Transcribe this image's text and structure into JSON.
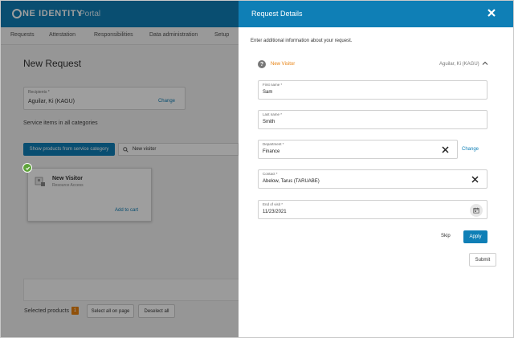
{
  "app": {
    "brand": "ONE IDENTITY",
    "brand_rest": "NE IDENTITY",
    "portal": "Portal"
  },
  "nav": {
    "items": [
      "Requests",
      "Attestation",
      "Responsibilities",
      "Data administration",
      "Setup"
    ]
  },
  "page": {
    "title": "New Request",
    "recipients_label": "Recipients *",
    "recipients_value": "Aguilar, Ki (KAGU)",
    "recipients_change": "Change",
    "service_heading": "Service items in all categories",
    "show_products_button": "Show products from service category",
    "search_value": "New visitor",
    "product": {
      "name": "New Visitor",
      "subtitle": "Resource Access",
      "add_to_cart": "Add to cart",
      "selected": true
    },
    "selected_products_label": "Selected products",
    "selected_count": "1",
    "select_all_button": "Select all on page",
    "deselect_all_button": "Deselect all"
  },
  "panel": {
    "title": "Request Details",
    "close_icon": "close-icon",
    "intro": "Enter additional information about your request.",
    "item_name": "New Visitor",
    "item_recipient": "Aguilar, Ki (KAGU)",
    "fields": {
      "first_name": {
        "label": "First name *",
        "value": "Sam"
      },
      "last_name": {
        "label": "Last name *",
        "value": "Smith"
      },
      "department": {
        "label": "Department *",
        "value": "Finance",
        "change": "Change"
      },
      "contact": {
        "label": "Contact *",
        "value": "Abelow, Tarus (TARUABE)"
      },
      "end_of_visit": {
        "label": "End of visit *",
        "value": "11/23/2021"
      }
    },
    "skip_button": "Skip",
    "apply_button": "Apply",
    "submit_button": "Submit"
  },
  "colors": {
    "brand_blue": "#0f7fb6",
    "accent_orange": "#e8810f",
    "success_green": "#5ea33a"
  }
}
